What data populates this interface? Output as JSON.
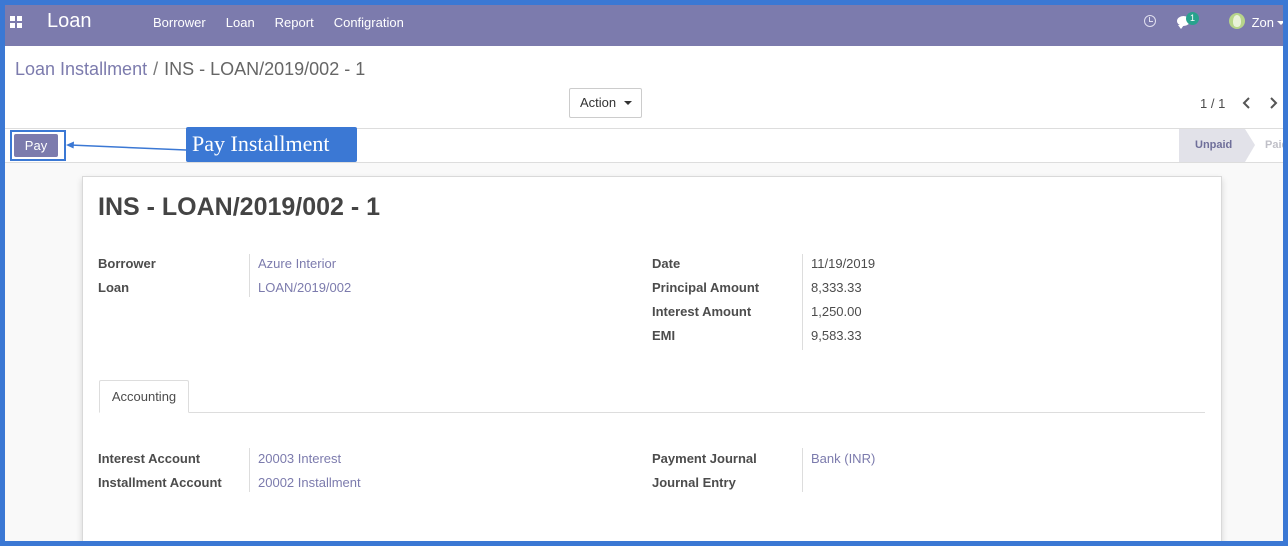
{
  "navbar": {
    "brand": "Loan",
    "menu": [
      "Borrower",
      "Loan",
      "Report",
      "Configration"
    ],
    "chat_count": "1",
    "user_name": "Zon",
    "color": "#7c7bad"
  },
  "breadcrumb": {
    "parent": "Loan Installment",
    "separator": "/",
    "current": "INS - LOAN/2019/002 - 1"
  },
  "toolbar": {
    "action_label": "Action",
    "pager": "1 / 1"
  },
  "statusbar": {
    "pay_label": "Pay",
    "callout": "Pay Installment",
    "stages": [
      "Unpaid",
      "Paid"
    ],
    "active_stage": "Unpaid"
  },
  "form": {
    "title": "INS - LOAN/2019/002 - 1",
    "left_fields": [
      {
        "label": "Borrower",
        "value": "Azure Interior"
      },
      {
        "label": "Loan",
        "value": "LOAN/2019/002"
      }
    ],
    "right_fields": [
      {
        "label": "Date",
        "value": "11/19/2019"
      },
      {
        "label": "Principal Amount",
        "value": "8,333.33"
      },
      {
        "label": "Interest Amount",
        "value": "1,250.00"
      },
      {
        "label": "EMI",
        "value": "9,583.33"
      }
    ],
    "tab": "Accounting",
    "accounting_left": [
      {
        "label": "Interest Account",
        "value": "20003 Interest"
      },
      {
        "label": "Installment Account",
        "value": "20002 Installment"
      }
    ],
    "accounting_right": [
      {
        "label": "Payment Journal",
        "value": "Bank (INR)"
      },
      {
        "label": "Journal Entry",
        "value": ""
      }
    ]
  }
}
